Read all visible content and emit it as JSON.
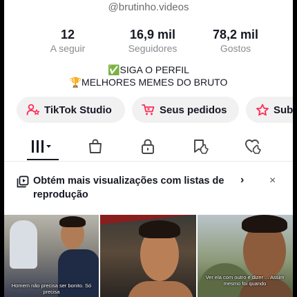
{
  "profile": {
    "username": "@brutinho.videos"
  },
  "stats": {
    "following": {
      "value": "12",
      "label": "A seguir"
    },
    "followers": {
      "value": "16,9 mil",
      "label": "Seguidores"
    },
    "likes": {
      "value": "78,2 mil",
      "label": "Gostos"
    }
  },
  "bio": {
    "line1": "✅SIGA O PERFIL",
    "line2": "🏆MELHORES MEMES DO BRUTO"
  },
  "buttons": {
    "studio": {
      "label": "TikTok Studio",
      "icon": "person-star-icon"
    },
    "orders": {
      "label": "Seus pedidos",
      "icon": "cart-icon"
    },
    "subs": {
      "label": "Subs",
      "icon": "star-icon"
    }
  },
  "tabs": [
    {
      "name": "videos-grid",
      "icon": "grid-icon",
      "selected": true
    },
    {
      "name": "shop",
      "icon": "bag-icon",
      "selected": false
    },
    {
      "name": "private",
      "icon": "lock-icon",
      "selected": false
    },
    {
      "name": "saved",
      "icon": "bookmark-hand-icon",
      "selected": false
    },
    {
      "name": "liked",
      "icon": "heart-hand-icon",
      "selected": false
    }
  ],
  "banner": {
    "text": "Obtém mais visualizações com listas de reprodução",
    "chevron": "›",
    "close": "×"
  },
  "videos": [
    {
      "caption": "Homem não precisa ser bonito. Só precisa"
    },
    {
      "caption": ""
    },
    {
      "caption": "Ver ela com outro e dizer ... Assim mesmo foi quando"
    }
  ],
  "colors": {
    "text": "#161823",
    "muted": "#8a8b91",
    "accent": "#fe2c55",
    "pill": "#f1f1f2"
  }
}
